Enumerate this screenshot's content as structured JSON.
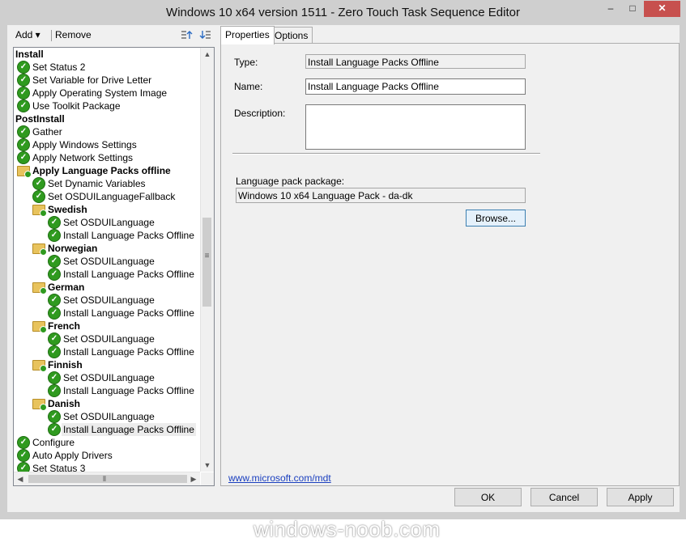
{
  "window": {
    "title": "Windows 10 x64 version 1511 - Zero Touch Task Sequence Editor",
    "minimize_glyph": "‒",
    "maximize_glyph": "□",
    "close_glyph": "✕"
  },
  "toolbar": {
    "add_label": "Add ▾",
    "remove_label": "Remove"
  },
  "tree": {
    "items": [
      {
        "label": "Install",
        "kind": "group",
        "level": 0
      },
      {
        "label": "Set Status 2",
        "kind": "step",
        "level": 0
      },
      {
        "label": "Set Variable for Drive Letter",
        "kind": "step",
        "level": 0
      },
      {
        "label": "Apply Operating System Image",
        "kind": "step",
        "level": 0
      },
      {
        "label": "Use Toolkit Package",
        "kind": "step",
        "level": 0
      },
      {
        "label": "PostInstall",
        "kind": "group",
        "level": 0
      },
      {
        "label": "Gather",
        "kind": "step",
        "level": 0
      },
      {
        "label": "Apply Windows Settings",
        "kind": "step",
        "level": 0
      },
      {
        "label": "Apply Network Settings",
        "kind": "step",
        "level": 0
      },
      {
        "label": "Apply Language Packs offline",
        "kind": "folder",
        "level": 0
      },
      {
        "label": "Set Dynamic Variables",
        "kind": "step",
        "level": 1
      },
      {
        "label": "Set OSDUILanguageFallback",
        "kind": "step",
        "level": 1
      },
      {
        "label": "Swedish",
        "kind": "folder",
        "level": 1
      },
      {
        "label": "Set OSDUILanguage",
        "kind": "step",
        "level": 2
      },
      {
        "label": "Install Language Packs Offline",
        "kind": "step",
        "level": 2
      },
      {
        "label": "Norwegian",
        "kind": "folder",
        "level": 1
      },
      {
        "label": "Set OSDUILanguage",
        "kind": "step",
        "level": 2
      },
      {
        "label": "Install Language Packs Offline",
        "kind": "step",
        "level": 2
      },
      {
        "label": "German",
        "kind": "folder",
        "level": 1
      },
      {
        "label": "Set OSDUILanguage",
        "kind": "step",
        "level": 2
      },
      {
        "label": "Install Language Packs Offline",
        "kind": "step",
        "level": 2
      },
      {
        "label": "French",
        "kind": "folder",
        "level": 1
      },
      {
        "label": "Set OSDUILanguage",
        "kind": "step",
        "level": 2
      },
      {
        "label": "Install Language Packs Offline",
        "kind": "step",
        "level": 2
      },
      {
        "label": "Finnish",
        "kind": "folder",
        "level": 1
      },
      {
        "label": "Set OSDUILanguage",
        "kind": "step",
        "level": 2
      },
      {
        "label": "Install Language Packs Offline",
        "kind": "step",
        "level": 2
      },
      {
        "label": "Danish",
        "kind": "folder",
        "level": 1
      },
      {
        "label": "Set OSDUILanguage",
        "kind": "step",
        "level": 2
      },
      {
        "label": "Install Language Packs Offline",
        "kind": "step",
        "level": 2,
        "selected": true
      },
      {
        "label": "Configure",
        "kind": "step",
        "level": 0
      },
      {
        "label": "Auto Apply Drivers",
        "kind": "step",
        "level": 0
      },
      {
        "label": "Set Status 3",
        "kind": "step",
        "level": 0
      }
    ]
  },
  "tabs": [
    {
      "label": "Properties",
      "active": true
    },
    {
      "label": "Options",
      "active": false
    }
  ],
  "properties": {
    "type_label": "Type:",
    "type_value": "Install Language Packs Offline",
    "name_label": "Name:",
    "name_value": "Install Language Packs Offline",
    "description_label": "Description:",
    "description_value": "",
    "package_label": "Language pack package:",
    "package_value": "Windows 10 x64 Language Pack - da-dk",
    "browse_label": "Browse...",
    "link_text": "www.microsoft.com/mdt"
  },
  "buttons": {
    "ok": "OK",
    "cancel": "Cancel",
    "apply": "Apply"
  },
  "watermark": "windows-noob.com",
  "colors": {
    "check_green": "#2f9a1f",
    "folder_yellow": "#e8c35d",
    "close_red": "#c7504e",
    "link_blue": "#1a3fbf"
  }
}
